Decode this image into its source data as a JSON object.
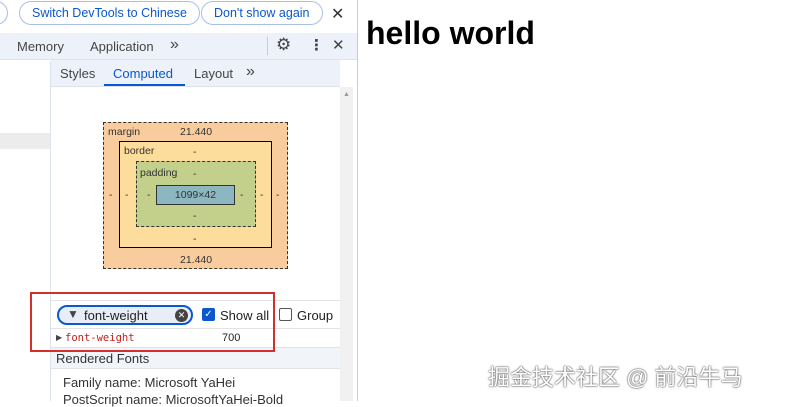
{
  "infobar": {
    "switch_label": "Switch DevTools to Chinese",
    "dont_show_label": "Don't show again",
    "close": "✕"
  },
  "tabs": {
    "items": [
      "Memory",
      "Application"
    ],
    "more": "»"
  },
  "subtabs": {
    "items": [
      "Styles",
      "Computed",
      "Layout"
    ],
    "active": "Computed",
    "more": "»"
  },
  "box_model": {
    "margin_label": "margin",
    "margin_top": "21.440",
    "margin_bottom": "21.440",
    "margin_left": "-",
    "margin_right": "-",
    "border_label": "border",
    "border_top": "-",
    "border_bottom": "-",
    "border_left": "-",
    "border_right": "-",
    "padding_label": "padding",
    "padding_top": "-",
    "padding_bottom": "-",
    "padding_left": "-",
    "padding_right": "-",
    "content": "1099×42"
  },
  "filter": {
    "value": "font-weight",
    "show_all_label": "Show all",
    "show_all_checked": true,
    "group_label": "Group",
    "group_checked": false
  },
  "property": {
    "name": "font-weight",
    "value": "700"
  },
  "rendered_fonts": {
    "title": "Rendered Fonts",
    "family": "Family name: Microsoft YaHei",
    "postscript": "PostScript name: MicrosoftYaHei-Bold"
  },
  "page": {
    "heading": "hello world"
  },
  "watermark": "掘金技术社区 @ 前沿牛马",
  "colors": {
    "accent": "#0b57d0",
    "highlight": "#d32f2f",
    "margin": "#f9cc9d",
    "border": "#fddd9b",
    "padding": "#c3d08b",
    "content": "#8cb6c0"
  }
}
